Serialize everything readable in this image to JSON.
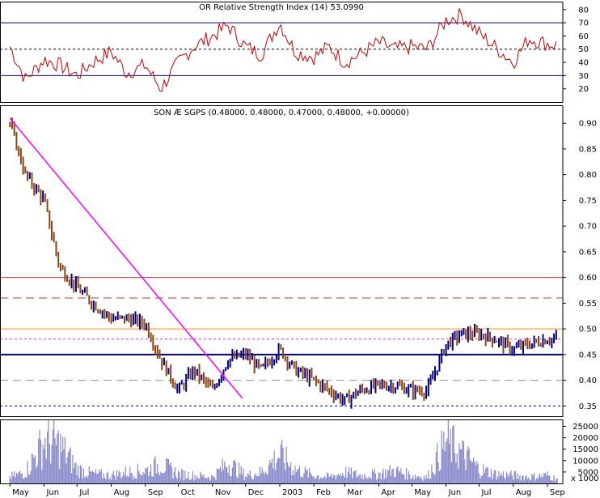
{
  "chart_data": [
    {
      "type": "line",
      "title": "OR Relative Strength Index (14) 53.0990",
      "ylim": [
        10,
        86
      ],
      "yticks": [
        20,
        30,
        40,
        50,
        60,
        70,
        80
      ],
      "reference_lines": [
        30,
        50,
        70
      ],
      "line_color": "#cc0000",
      "x_months": [
        "May",
        "Jun",
        "Jul",
        "Aug",
        "Sep",
        "Oct",
        "Nov",
        "Dec",
        "2003",
        "Feb",
        "Mar",
        "Apr",
        "May",
        "Jun",
        "Jul",
        "Aug",
        "Sep"
      ],
      "series": [
        {
          "x": [
            "2002-05-01",
            "2002-05-15",
            "2002-06-01",
            "2002-06-15",
            "2002-07-01",
            "2002-07-15",
            "2002-08-01",
            "2002-08-15",
            "2002-09-01",
            "2002-09-15",
            "2002-10-01",
            "2002-10-15",
            "2002-11-01",
            "2002-11-15",
            "2002-12-01",
            "2002-12-15",
            "2003-01-01",
            "2003-01-15",
            "2003-02-01",
            "2003-02-15",
            "2003-03-01",
            "2003-03-15",
            "2003-04-01",
            "2003-04-15",
            "2003-05-01",
            "2003-05-15",
            "2003-06-01",
            "2003-06-15",
            "2003-07-01",
            "2003-07-15",
            "2003-08-01",
            "2003-08-15",
            "2003-09-01",
            "2003-09-10"
          ],
          "values": [
            52,
            27,
            42,
            38,
            30,
            40,
            48,
            32,
            38,
            20,
            40,
            52,
            60,
            68,
            52,
            46,
            70,
            48,
            44,
            52,
            40,
            46,
            55,
            50,
            52,
            50,
            72,
            76,
            62,
            52,
            40,
            58,
            54,
            53
          ]
        }
      ]
    },
    {
      "type": "ohlc",
      "title": "SON Æ SGPS (0.48000, 0.48000, 0.47000, 0.48000, +0.00000)",
      "ylim": [
        0.33,
        0.935
      ],
      "yticks": [
        0.35,
        0.4,
        0.45,
        0.5,
        0.55,
        0.6,
        0.65,
        0.7,
        0.75,
        0.8,
        0.85,
        0.9
      ],
      "up_color": "#00008b",
      "down_color": "#8b4513",
      "reference_lines": [
        {
          "value": 0.6,
          "style": "solid",
          "color": "#cc3333"
        },
        {
          "value": 0.56,
          "style": "dashed",
          "color": "#cc3333"
        },
        {
          "value": 0.5,
          "style": "solid",
          "color": "#ff8800"
        },
        {
          "value": 0.48,
          "style": "dotted",
          "color": "#cc33cc"
        },
        {
          "value": 0.45,
          "style": "solid",
          "color": "#00008b"
        },
        {
          "value": 0.4,
          "style": "dashed",
          "color": "#8888cc"
        },
        {
          "value": 0.35,
          "style": "dotted",
          "color": "#00008b"
        }
      ],
      "trendline": {
        "color": "#ff00ff",
        "from": {
          "x": "2002-05-01",
          "y": 0.91
        },
        "to": {
          "x": "2002-11-28",
          "y": 0.365
        }
      },
      "series": [
        {
          "name": "Close",
          "x": [
            "2002-05-01",
            "2002-05-15",
            "2002-06-01",
            "2002-06-15",
            "2002-07-01",
            "2002-07-15",
            "2002-08-01",
            "2002-08-15",
            "2002-09-01",
            "2002-09-15",
            "2002-10-01",
            "2002-10-15",
            "2002-11-01",
            "2002-11-15",
            "2002-12-01",
            "2002-12-15",
            "2003-01-01",
            "2003-01-15",
            "2003-02-01",
            "2003-02-15",
            "2003-03-01",
            "2003-03-15",
            "2003-04-01",
            "2003-04-15",
            "2003-05-01",
            "2003-05-15",
            "2003-06-01",
            "2003-06-15",
            "2003-07-01",
            "2003-07-15",
            "2003-08-01",
            "2003-08-15",
            "2003-09-01",
            "2003-09-10"
          ],
          "values": [
            0.9,
            0.8,
            0.75,
            0.62,
            0.58,
            0.55,
            0.52,
            0.52,
            0.51,
            0.44,
            0.38,
            0.42,
            0.38,
            0.44,
            0.45,
            0.42,
            0.46,
            0.42,
            0.4,
            0.38,
            0.36,
            0.38,
            0.39,
            0.39,
            0.38,
            0.38,
            0.47,
            0.49,
            0.49,
            0.48,
            0.46,
            0.47,
            0.48,
            0.48
          ]
        }
      ]
    },
    {
      "type": "bar",
      "title": "",
      "ylim": [
        0,
        28000
      ],
      "yticks": [
        5000,
        10000,
        15000,
        20000,
        25000
      ],
      "ytick_labels": [
        "5000",
        "10000",
        "15000",
        "20000",
        "25000"
      ],
      "unit_label": "x 1000",
      "bar_color": "#8888cc",
      "series": [
        {
          "x": [
            "2002-05-01",
            "2002-05-15",
            "2002-06-01",
            "2002-06-15",
            "2002-07-01",
            "2002-07-15",
            "2002-08-01",
            "2002-08-15",
            "2002-09-01",
            "2002-09-15",
            "2002-10-01",
            "2002-10-15",
            "2002-11-01",
            "2002-11-15",
            "2002-12-01",
            "2002-12-15",
            "2003-01-01",
            "2003-01-15",
            "2003-02-01",
            "2003-02-15",
            "2003-03-01",
            "2003-03-15",
            "2003-04-01",
            "2003-04-15",
            "2003-05-01",
            "2003-05-15",
            "2003-06-01",
            "2003-06-15",
            "2003-07-01",
            "2003-07-15",
            "2003-08-01",
            "2003-08-15",
            "2003-09-01",
            "2003-09-10"
          ],
          "values": [
            4000,
            7000,
            26000,
            24000,
            9000,
            6000,
            5000,
            7000,
            8000,
            12000,
            6000,
            5000,
            4000,
            13000,
            5000,
            7000,
            18000,
            9000,
            5000,
            4000,
            7000,
            5000,
            6000,
            8000,
            5000,
            4000,
            26000,
            19000,
            9000,
            6000,
            5000,
            4000,
            5000,
            3000
          ]
        }
      ]
    }
  ],
  "x_axis": {
    "labels": [
      "May",
      "Jun",
      "Jul",
      "Aug",
      "Sep",
      "Oct",
      "Nov",
      "Dec",
      "2003",
      "Feb",
      "Mar",
      "Apr",
      "May",
      "Jun",
      "Jul",
      "Aug",
      "Sep"
    ]
  }
}
